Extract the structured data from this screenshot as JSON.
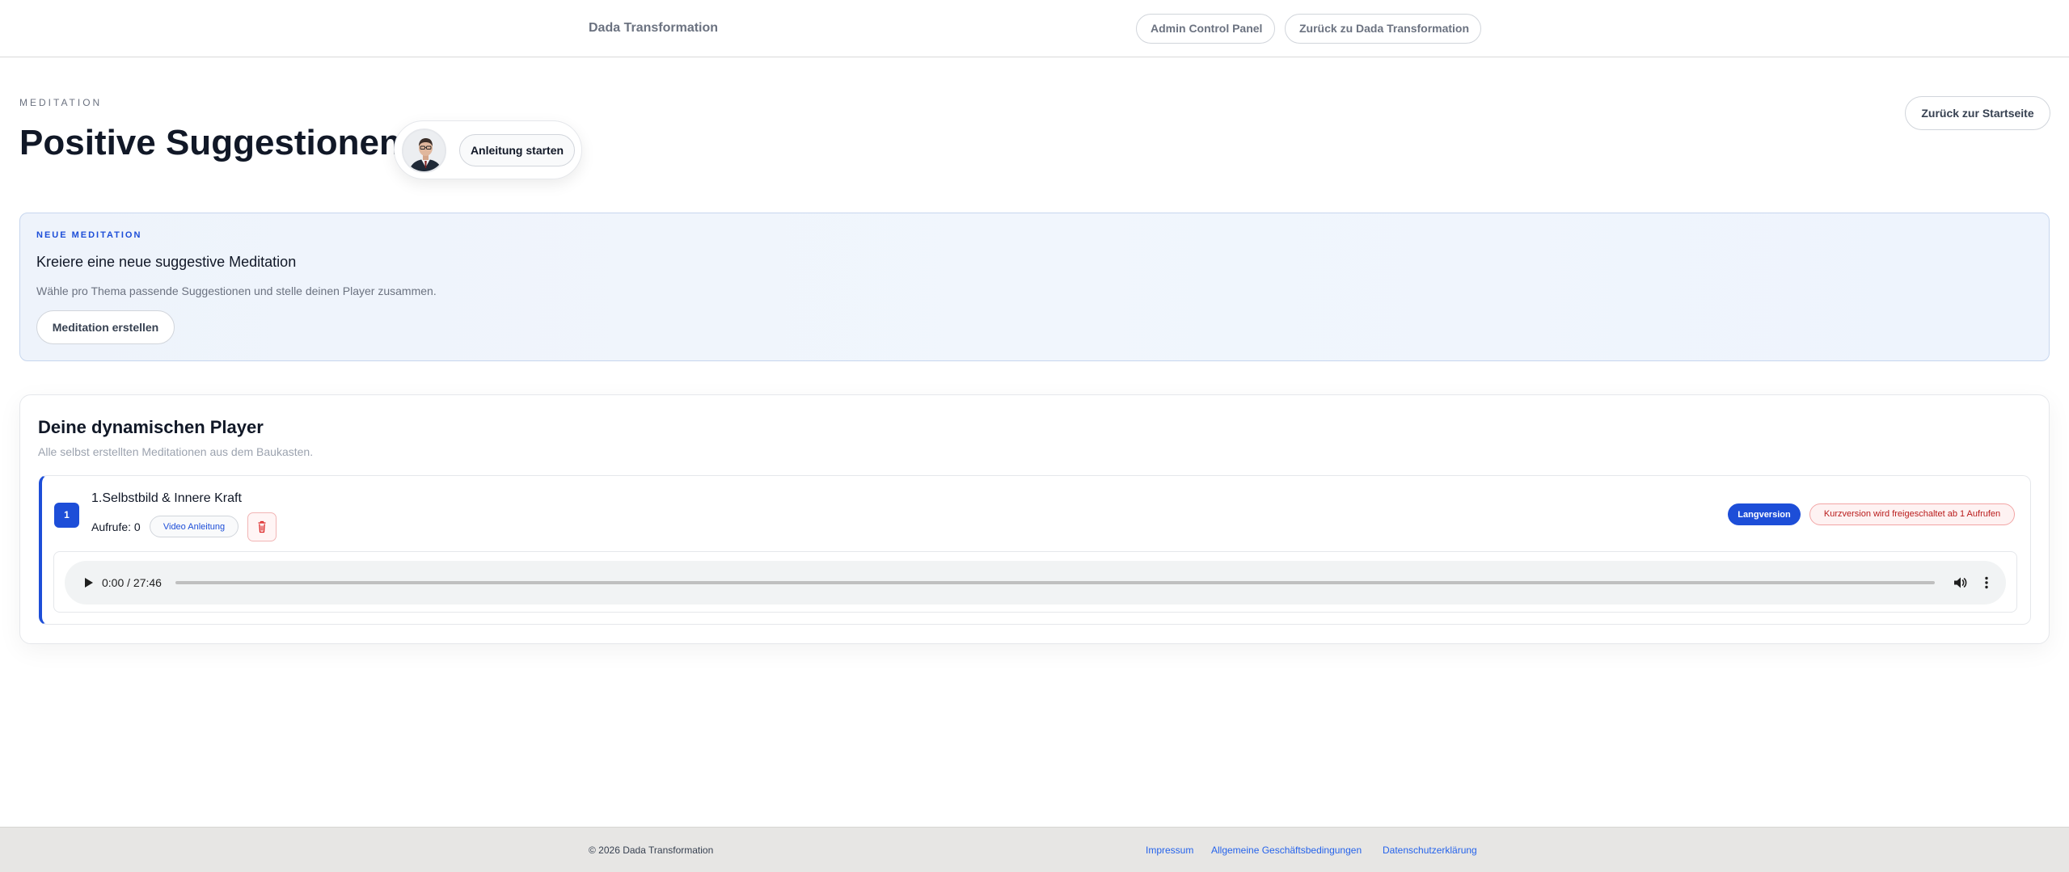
{
  "nav": {
    "brand": "Dada Transformation",
    "admin_label": "Admin Control Panel",
    "back_label": "Zurück zu Dada Transformation"
  },
  "header": {
    "eyebrow": "MEDITATION",
    "title": "Positive Suggestionen",
    "guide_button": "Anleitung starten",
    "home_button": "Zurück zur Startseite"
  },
  "new_meditation": {
    "eyebrow": "NEUE MEDITATION",
    "title": "Kreiere eine neue suggestive Meditation",
    "description": "Wähle pro Thema passende Suggestionen und stelle deinen Player zusammen.",
    "button": "Meditation erstellen"
  },
  "players": {
    "title": "Deine dynamischen Player",
    "subtitle": "Alle selbst erstellten Meditationen aus dem Baukasten.",
    "items": [
      {
        "number": "1",
        "title": "1.Selbstbild & Innere Kraft",
        "views": "Aufrufe: 0",
        "video_label": "Video Anleitung",
        "version_label": "Langversion",
        "short_notice": "Kurzversion wird freigeschaltet ab 1 Aufrufen",
        "time": "0:00 / 27:46",
        "progress": 0
      }
    ]
  },
  "footer": {
    "copyright": "© 2026 Dada Transformation",
    "links": [
      "Impressum",
      "Allgemeine Geschäftsbedingungen",
      "Datenschutzerklärung"
    ]
  },
  "colors": {
    "accent": "#1d4ed8",
    "danger": "#b91c1c",
    "footer_bg": "#e7e6e4"
  },
  "icons": {
    "delete": "trash-icon",
    "play": "play-icon",
    "volume": "volume-icon",
    "more": "more-vertical-icon",
    "avatar": "avatar-portrait"
  }
}
